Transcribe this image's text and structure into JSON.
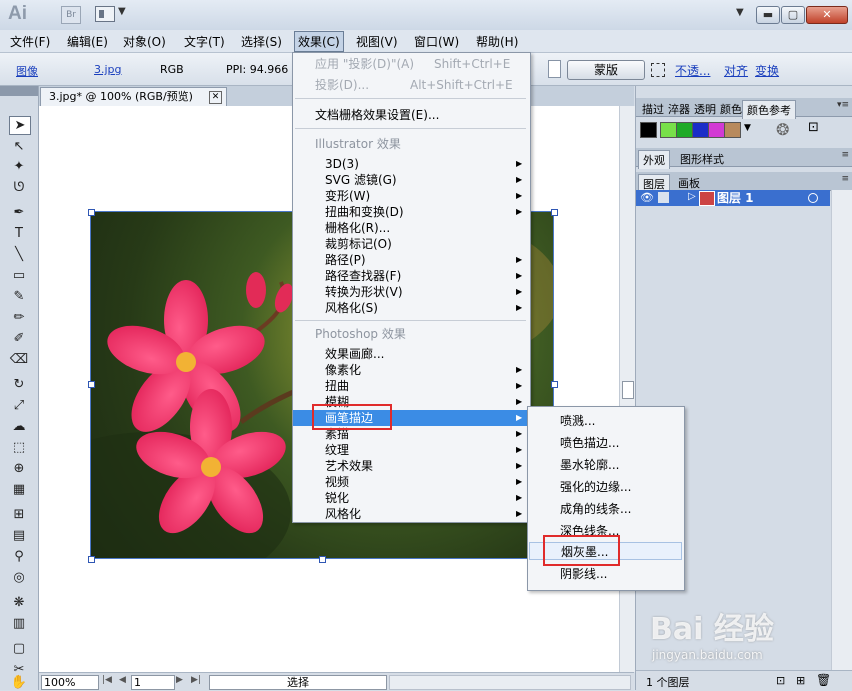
{
  "app": {
    "logo": "Ai",
    "bridge_icon": "Br",
    "arrange_icon": "arrange-documents-icon",
    "minimize": "▬",
    "maximize": "▢",
    "close": "✕"
  },
  "menubar": {
    "items": [
      "文件(F)",
      "编辑(E)",
      "对象(O)",
      "文字(T)",
      "选择(S)",
      "效果(C)",
      "视图(V)",
      "窗口(W)",
      "帮助(H)"
    ]
  },
  "controlbar": {
    "type_label": "图像",
    "filename": "3.jpg",
    "color_mode": "RGB",
    "ppi": "PPI: 94.966",
    "mask_button": "蒙版",
    "opacity_link": "不透...",
    "align_link": "对齐",
    "transform_link": "变换"
  },
  "document": {
    "tab_title": "3.jpg* @ 100% (RGB/预览)",
    "tab_close": "✕"
  },
  "statusbar": {
    "zoom": "100%",
    "page": "1",
    "mode": "选择"
  },
  "effect_menu": {
    "apply_last": {
      "label": "应用 \"投影(D)\"(A)",
      "shortcut": "Shift+Ctrl+E"
    },
    "last_effect": {
      "label": "投影(D)...",
      "shortcut": "Alt+Shift+Ctrl+E"
    },
    "raster_settings": "文档栅格效果设置(E)...",
    "illustrator_header": "Illustrator 效果",
    "illustrator_items": [
      "3D(3)",
      "SVG 滤镜(G)",
      "变形(W)",
      "扭曲和变换(D)",
      "栅格化(R)...",
      "裁剪标记(O)",
      "路径(P)",
      "路径查找器(F)",
      "转换为形状(V)",
      "风格化(S)"
    ],
    "photoshop_header": "Photoshop 效果",
    "photoshop_items": [
      "效果画廊...",
      "像素化",
      "扭曲",
      "模糊",
      "画笔描边",
      "素描",
      "纹理",
      "艺术效果",
      "视频",
      "锐化",
      "风格化"
    ]
  },
  "brush_submenu": {
    "items": [
      "喷溅...",
      "喷色描边...",
      "墨水轮廓...",
      "强化的边缘...",
      "成角的线条...",
      "深色线条...",
      "烟灰墨...",
      "阴影线..."
    ],
    "highlighted": "烟灰墨..."
  },
  "right_panels": {
    "top_tabs": [
      "描过",
      "淬器",
      "透明",
      "颜色",
      "颜色参考"
    ],
    "mid_tabs": [
      "外观",
      "图形样式"
    ],
    "layer_tabs": [
      "图层",
      "画板"
    ],
    "layer_name": "图层 1",
    "footer_count": "1 个图层",
    "swatch_colors": [
      "#000000",
      "#78e04a",
      "#1faa27",
      "#1b2ec8",
      "#d23ad4",
      "#b88a5d"
    ]
  },
  "watermark": {
    "brand": "Bai 经验",
    "url": "jingyan.baidu.com"
  },
  "colors": {
    "menu_highlight": "#3b8ce5",
    "annotation_red": "#e02b2b",
    "selection_blue": "#3a6fcf"
  }
}
